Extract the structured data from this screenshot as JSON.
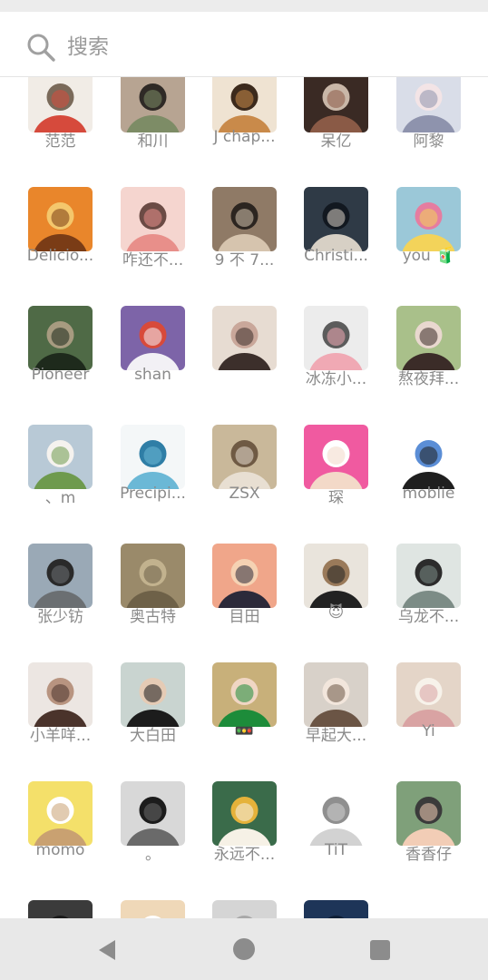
{
  "search": {
    "placeholder": "搜索"
  },
  "colors": {
    "label": "#8a8a8a",
    "nav_icon": "#8c8c8c",
    "nav_bg": "#e8e8e8"
  },
  "friends": [
    {
      "name": "范范",
      "avatar": "red-flowers-photo",
      "palette": [
        "#f1ece6",
        "#d64a3c",
        "#7a6a5a"
      ]
    },
    {
      "name": "和川",
      "avatar": "girl-headscarf-photo",
      "palette": [
        "#b7a492",
        "#7d8c66",
        "#2f2a26"
      ]
    },
    {
      "name": "J chap...",
      "avatar": "shiba-dog-photo",
      "palette": [
        "#efe3d2",
        "#c98a4a",
        "#3c2a1c"
      ]
    },
    {
      "name": "呆亿",
      "avatar": "dark-room-photo",
      "palette": [
        "#3a2a24",
        "#8a5a46",
        "#c9b7a8"
      ]
    },
    {
      "name": "阿黎",
      "avatar": "anime-silver-hair",
      "palette": [
        "#d9dde8",
        "#8e93ad",
        "#f3e4e6"
      ]
    },
    {
      "name": "Delicio...",
      "avatar": "orange-flowers-girl",
      "palette": [
        "#e9862b",
        "#7a3c16",
        "#f4c76c"
      ]
    },
    {
      "name": "咋还不...",
      "avatar": "anime-pink-girl",
      "palette": [
        "#f5d5cf",
        "#e88f8a",
        "#6b4b45"
      ]
    },
    {
      "name": "9 不 7...",
      "avatar": "mirror-selfie-photo",
      "palette": [
        "#8f7a66",
        "#d6c4ae",
        "#2c2520"
      ]
    },
    {
      "name": "Christi...",
      "avatar": "boy-glasses-photo",
      "palette": [
        "#2f3a46",
        "#d7d0c5",
        "#121820"
      ]
    },
    {
      "name": "you 🧃",
      "avatar": "cartoon-princess",
      "palette": [
        "#9bc8d8",
        "#f3d35a",
        "#e57da0"
      ]
    },
    {
      "name": "Pioneer",
      "avatar": "dark-portrait-photo",
      "palette": [
        "#4f6a46",
        "#1e2a1c",
        "#a79b80"
      ]
    },
    {
      "name": "shan",
      "avatar": "purple-doraemon",
      "palette": [
        "#7d64a8",
        "#f2f0f5",
        "#d84a3a"
      ]
    },
    {
      "name": "",
      "avatar": "girl-portrait-photo",
      "palette": [
        "#e7dcd2",
        "#3c2f2b",
        "#c9a79a"
      ]
    },
    {
      "name": "冰冻小...",
      "avatar": "pink-cartoon-cat",
      "palette": [
        "#ececec",
        "#f0a9b4",
        "#5c5c5c"
      ]
    },
    {
      "name": "熬夜拜...",
      "avatar": "girl-green-photo",
      "palette": [
        "#a9c08a",
        "#3b2c28",
        "#e9d8cf"
      ]
    },
    {
      "name": "、m",
      "avatar": "snowy-mountain-girl",
      "palette": [
        "#b8c9d6",
        "#6e9a4e",
        "#f5f2ee"
      ]
    },
    {
      "name": "Precipi...",
      "avatar": "blue-whale-drawing",
      "palette": [
        "#f4f7f8",
        "#6bb8d6",
        "#2f7ea6"
      ]
    },
    {
      "name": "ZSX",
      "avatar": "dog-straw-hat",
      "palette": [
        "#c9b89a",
        "#e8dfd2",
        "#6f5a44"
      ]
    },
    {
      "name": "琛",
      "avatar": "cartoon-man-pink",
      "palette": [
        "#f05aa0",
        "#f3d9c8",
        "#ffffff"
      ]
    },
    {
      "name": "moblie",
      "avatar": "white-bunny-drawing",
      "palette": [
        "#ffffff",
        "#1f1f1f",
        "#5b8ed6"
      ]
    },
    {
      "name": "张少钫",
      "avatar": "building-penguin-photo",
      "palette": [
        "#9aa9b6",
        "#6b6f72",
        "#2a2a2a"
      ]
    },
    {
      "name": "奥古特",
      "avatar": "tan-curtain-texture",
      "palette": [
        "#9a8a6a",
        "#6e6148",
        "#c2b28e"
      ]
    },
    {
      "name": "目田",
      "avatar": "anime-girl-sunset",
      "palette": [
        "#f0a68a",
        "#2c2a3a",
        "#f5d2b3"
      ]
    },
    {
      "name": "😈",
      "avatar": "white-dog-shades",
      "palette": [
        "#e9e4dc",
        "#222222",
        "#9a7a5a"
      ]
    },
    {
      "name": "乌龙不...",
      "avatar": "boy-white-shirt-photo",
      "palette": [
        "#dfe5e2",
        "#7c8c86",
        "#2c2c2c"
      ]
    },
    {
      "name": "小羊咩...",
      "avatar": "girl-long-hair-photo",
      "palette": [
        "#ece6e2",
        "#4a332b",
        "#b89480"
      ]
    },
    {
      "name": "大白田",
      "avatar": "man-portrait-photo",
      "palette": [
        "#c9d4d0",
        "#1c1c1c",
        "#e5cbb5"
      ]
    },
    {
      "name": "🚥",
      "avatar": "girl-green-glasses",
      "palette": [
        "#c8b07a",
        "#1d8c3a",
        "#f0d6c4"
      ]
    },
    {
      "name": "早起大...",
      "avatar": "baby-cat-photo",
      "palette": [
        "#d8d1c9",
        "#6b5545",
        "#f2e6dc"
      ]
    },
    {
      "name": "Yi",
      "avatar": "girl-mirror-photo",
      "palette": [
        "#e4d5c8",
        "#d9a3a3",
        "#f7f2ea"
      ]
    },
    {
      "name": "momo",
      "avatar": "hamster-yellow",
      "palette": [
        "#f4e06a",
        "#c9a171",
        "#ffffff"
      ]
    },
    {
      "name": "。",
      "avatar": "bw-street-photo",
      "palette": [
        "#d8d8d8",
        "#6a6a6a",
        "#1c1c1c"
      ]
    },
    {
      "name": "永远不...",
      "avatar": "flower-plush-photo",
      "palette": [
        "#3a6b4a",
        "#f6f1e6",
        "#e5b23a"
      ]
    },
    {
      "name": "TiT",
      "avatar": "soft-white-blur",
      "palette": [
        "#ffffff",
        "#d2d2d2",
        "#8f8f8f"
      ]
    },
    {
      "name": "香香仔",
      "avatar": "baby-crying-photo",
      "palette": [
        "#7fa07a",
        "#f2cdb6",
        "#3b3b3b"
      ]
    },
    {
      "name": "",
      "avatar": "couple-dark-photo",
      "palette": [
        "#3b3b3b",
        "#c9b39e",
        "#1a1a1a"
      ]
    },
    {
      "name": "",
      "avatar": "peach-blur-photo",
      "palette": [
        "#efd8b8",
        "#e7b58a",
        "#ffffff"
      ]
    },
    {
      "name": "",
      "avatar": "dark-hair-photo",
      "palette": [
        "#d5d5d5",
        "#1e1e1e",
        "#a8a8a8"
      ]
    },
    {
      "name": "",
      "avatar": "navy-block",
      "palette": [
        "#1e3558",
        "#2b4a75",
        "#0f1f36"
      ]
    }
  ],
  "nav": {
    "back": "back-icon",
    "home": "home-icon",
    "recent": "recent-apps-icon"
  }
}
